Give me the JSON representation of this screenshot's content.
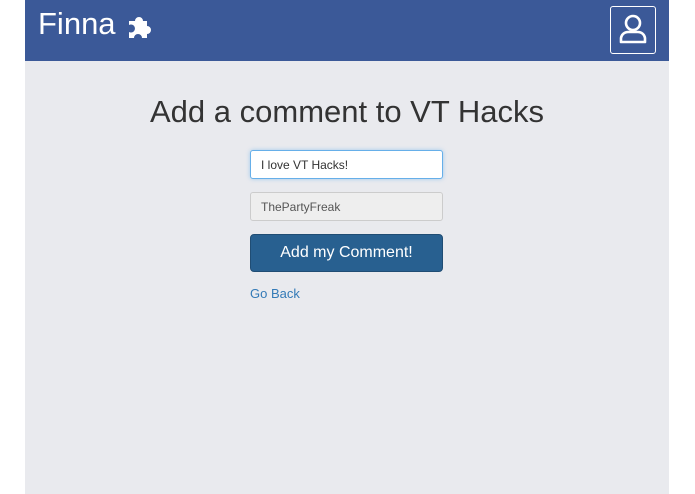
{
  "navbar": {
    "brand": "Finna",
    "brand_icon": "puzzle-icon",
    "profile_icon": "user-icon",
    "background": "#3b5998"
  },
  "main": {
    "heading": "Add a comment to VT Hacks",
    "comment_input": {
      "value": "I love VT Hacks!"
    },
    "name_input": {
      "value": "ThePartyFreak"
    },
    "submit_label": "Add my Comment!",
    "back_label": "Go Back"
  },
  "colors": {
    "page_background": "#e9eaee",
    "primary_button": "#286090",
    "link": "#337ab7"
  }
}
